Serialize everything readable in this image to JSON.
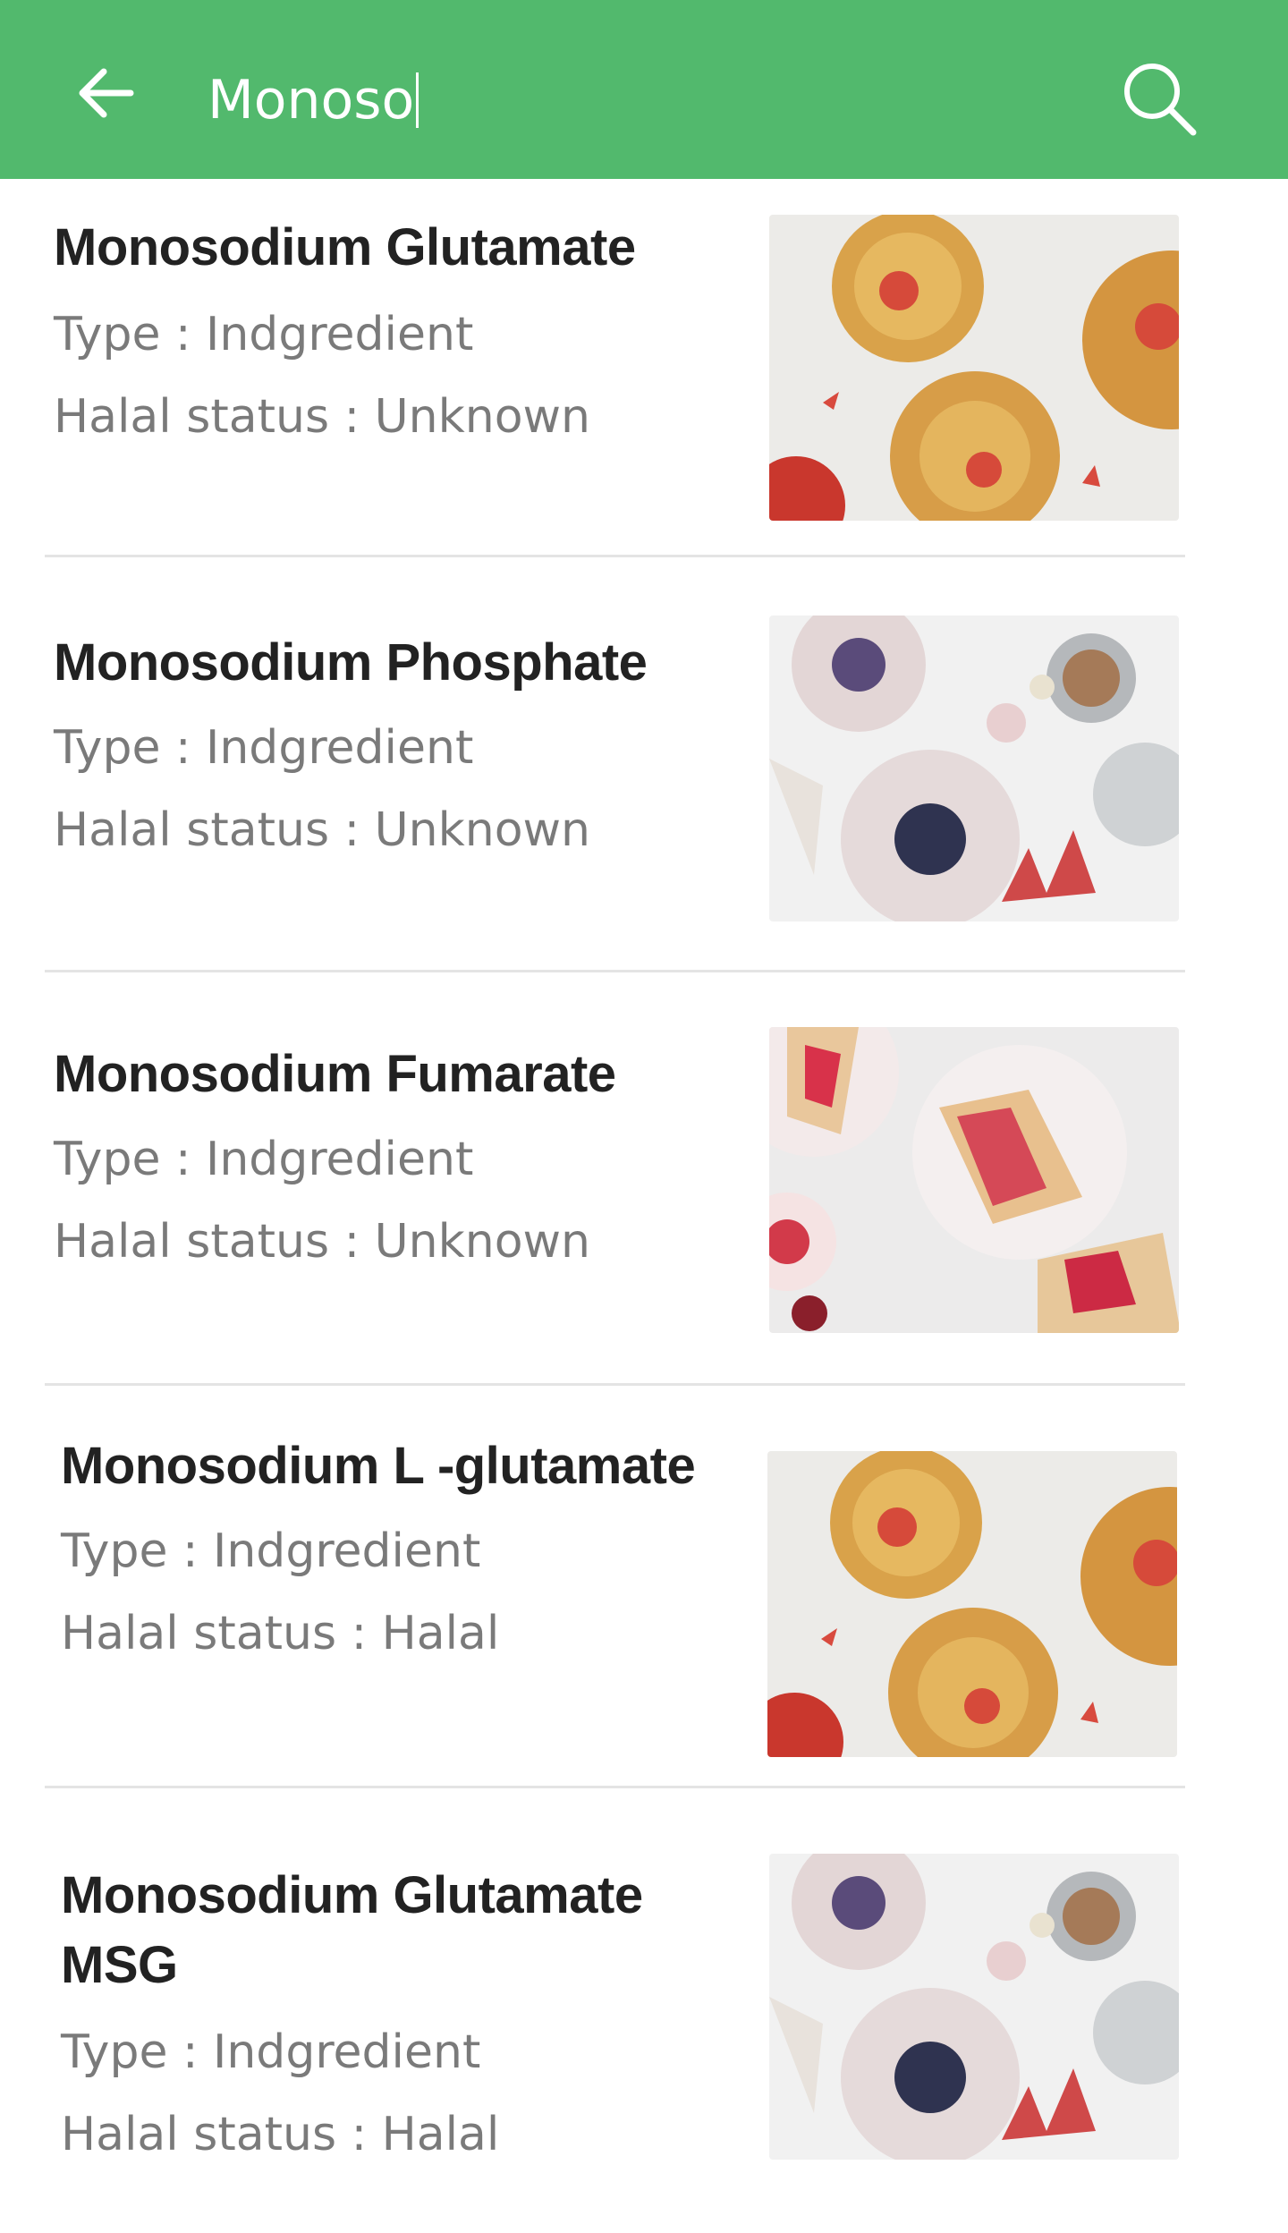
{
  "search": {
    "query": "Monoso"
  },
  "icons": {
    "back": "arrow-left-icon",
    "search": "search-icon"
  },
  "colors": {
    "appbar": "#52b96d"
  },
  "items": [
    {
      "title": "Monosodium Glutamate",
      "type": "Type : Indgredient",
      "status": "Halal status : Unknown",
      "image": "pastry-photo"
    },
    {
      "title": "Monosodium Phosphate",
      "type": "Type : Indgredient",
      "status": "Halal status : Unknown",
      "image": "waffles-photo"
    },
    {
      "title": "Monosodium Fumarate",
      "type": "Type : Indgredient",
      "status": "Halal status : Unknown",
      "image": "cake-photo"
    },
    {
      "title": "Monosodium L -glutamate",
      "type": "Type : Indgredient",
      "status": "Halal status : Halal",
      "image": "pastry-photo"
    },
    {
      "title": "Monosodium Glutamate MSG",
      "type": "Type : Indgredient",
      "status": "Halal status : Halal",
      "image": "waffles-photo"
    }
  ]
}
